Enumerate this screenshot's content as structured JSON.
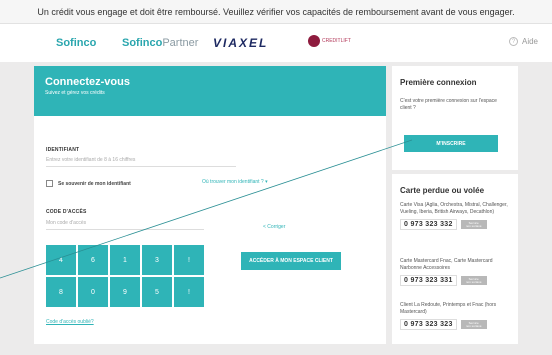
{
  "banner": "Un crédit vous engage et doit être remboursé. Veuillez vérifier vos capacités de remboursement avant de vous engager.",
  "header": {
    "logo_sofinco": "Sofinco",
    "logo_partner_brand": "Sofinco",
    "logo_partner_word": "Partner",
    "logo_viaxel": "VIAXEL",
    "logo_credit": "CREDITLIFT",
    "help_label": "Aide"
  },
  "login": {
    "title": "Connectez-vous",
    "subtitle": "Suivez et gérez vos crédits",
    "identifiant_label": "IDENTIFIANT",
    "identifiant_placeholder": "Entrez votre identifiant de 8 à 16 chiffres",
    "remember_label": "Se souvenir de mon identifiant",
    "where_link": "Où trouver mon identifiant ?",
    "code_label": "CODE D'ACCÈS",
    "code_placeholder": "Mon code d'accès",
    "keypad": [
      "4",
      "6",
      "1",
      "3",
      "!",
      "8",
      "0",
      "9",
      "5",
      "!"
    ],
    "corriger": "< Corriger",
    "access_button": "ACCÉDER À MON ESPACE CLIENT",
    "forgot_link": "Code d'accès oublié?"
  },
  "first_connection": {
    "title": "Première connexion",
    "description": "C'est votre première connexion sur l'espace client ?",
    "button": "M'INSCRIRE"
  },
  "lost_card": {
    "title": "Carte perdue ou volée",
    "items": [
      {
        "description": "Carte Visa (Aglia, Orchestra, Mistral, Challenger, Vueling, Iberia, British Airways, Decathlon)",
        "phone": "0 973 323 332",
        "tag_top": "Service",
        "tag_bottom": "non surtaxé"
      },
      {
        "description": "Carte Mastercard Fnac, Carte Mastercard Narbonne Accessoires",
        "phone": "0 973 323 331",
        "tag_top": "Service",
        "tag_bottom": "non surtaxé"
      },
      {
        "description": "Client La Redoute, Printemps et Fnac (hors Mastercard)",
        "phone": "0 973 323 323",
        "tag_top": "Service",
        "tag_bottom": "non surtaxé"
      }
    ]
  },
  "colors": {
    "accent": "#2fb4b7",
    "background": "#ecebeb"
  }
}
